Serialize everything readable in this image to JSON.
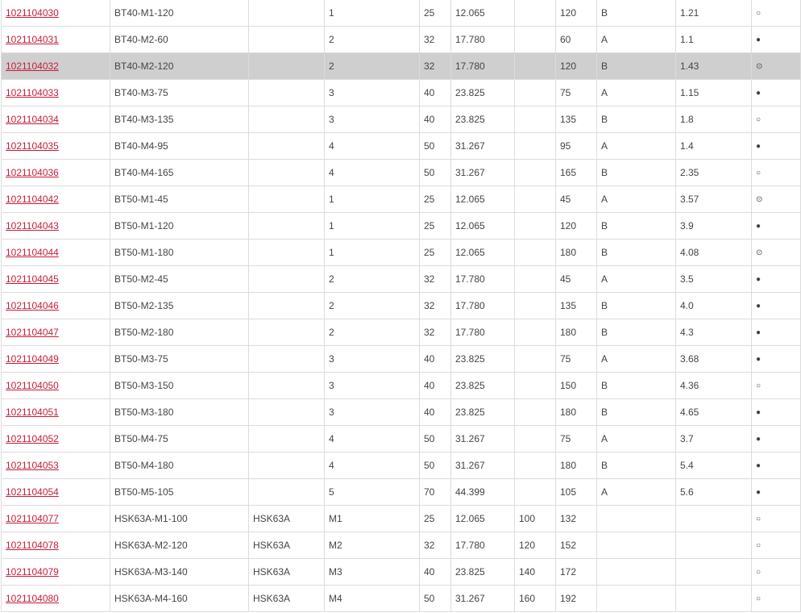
{
  "table": {
    "selected_row": 2,
    "rows": [
      [
        "1021104030",
        "BT40-M1-120",
        "",
        "1",
        "25",
        "12.065",
        "",
        "120",
        "B",
        "1.21",
        "○"
      ],
      [
        "1021104031",
        "BT40-M2-60",
        "",
        "2",
        "32",
        "17.780",
        "",
        "60",
        "A",
        "1.1",
        "●"
      ],
      [
        "1021104032",
        "BT40-M2-120",
        "",
        "2",
        "32",
        "17.780",
        "",
        "120",
        "B",
        "1.43",
        "⊙"
      ],
      [
        "1021104033",
        "BT40-M3-75",
        "",
        "3",
        "40",
        "23.825",
        "",
        "75",
        "A",
        "1.15",
        "●"
      ],
      [
        "1021104034",
        "BT40-M3-135",
        "",
        "3",
        "40",
        "23.825",
        "",
        "135",
        "B",
        "1.8",
        "○"
      ],
      [
        "1021104035",
        "BT40-M4-95",
        "",
        "4",
        "50",
        "31.267",
        "",
        "95",
        "A",
        "1.4",
        "●"
      ],
      [
        "1021104036",
        "BT40-M4-165",
        "",
        "4",
        "50",
        "31.267",
        "",
        "165",
        "B",
        "2.35",
        "○"
      ],
      [
        "1021104042",
        "BT50-M1-45",
        "",
        "1",
        "25",
        "12.065",
        "",
        "45",
        "A",
        "3.57",
        "⊙"
      ],
      [
        "1021104043",
        "BT50-M1-120",
        "",
        "1",
        "25",
        "12.065",
        "",
        "120",
        "B",
        "3.9",
        "●"
      ],
      [
        "1021104044",
        "BT50-M1-180",
        "",
        "1",
        "25",
        "12.065",
        "",
        "180",
        "B",
        "4.08",
        "⊙"
      ],
      [
        "1021104045",
        "BT50-M2-45",
        "",
        "2",
        "32",
        "17.780",
        "",
        "45",
        "A",
        "3.5",
        "●"
      ],
      [
        "1021104046",
        "BT50-M2-135",
        "",
        "2",
        "32",
        "17.780",
        "",
        "135",
        "B",
        "4.0",
        "●"
      ],
      [
        "1021104047",
        "BT50-M2-180",
        "",
        "2",
        "32",
        "17.780",
        "",
        "180",
        "B",
        "4.3",
        "●"
      ],
      [
        "1021104049",
        "BT50-M3-75",
        "",
        "3",
        "40",
        "23.825",
        "",
        "75",
        "A",
        "3.68",
        "●"
      ],
      [
        "1021104050",
        "BT50-M3-150",
        "",
        "3",
        "40",
        "23.825",
        "",
        "150",
        "B",
        "4.36",
        "○"
      ],
      [
        "1021104051",
        "BT50-M3-180",
        "",
        "3",
        "40",
        "23.825",
        "",
        "180",
        "B",
        "4.65",
        "●"
      ],
      [
        "1021104052",
        "BT50-M4-75",
        "",
        "4",
        "50",
        "31.267",
        "",
        "75",
        "A",
        "3.7",
        "●"
      ],
      [
        "1021104053",
        "BT50-M4-180",
        "",
        "4",
        "50",
        "31.267",
        "",
        "180",
        "B",
        "5.4",
        "●"
      ],
      [
        "1021104054",
        "BT50-M5-105",
        "",
        "5",
        "70",
        "44.399",
        "",
        "105",
        "A",
        "5.6",
        "●"
      ],
      [
        "1021104077",
        "HSK63A-M1-100",
        "HSK63A",
        "M1",
        "25",
        "12.065",
        "100",
        "132",
        "",
        "",
        "○"
      ],
      [
        "1021104078",
        "HSK63A-M2-120",
        "HSK63A",
        "M2",
        "32",
        "17.780",
        "120",
        "152",
        "",
        "",
        "○"
      ],
      [
        "1021104079",
        "HSK63A-M3-140",
        "HSK63A",
        "M3",
        "40",
        "23.825",
        "140",
        "172",
        "",
        "",
        "○"
      ],
      [
        "1021104080",
        "HSK63A-M4-160",
        "HSK63A",
        "M4",
        "50",
        "31.267",
        "160",
        "192",
        "",
        "",
        "○"
      ]
    ]
  },
  "colors": {
    "link": "#c41e3a",
    "selected_row_bg": "#cfcfcf",
    "border": "#dcdcdc",
    "text": "#444444"
  }
}
